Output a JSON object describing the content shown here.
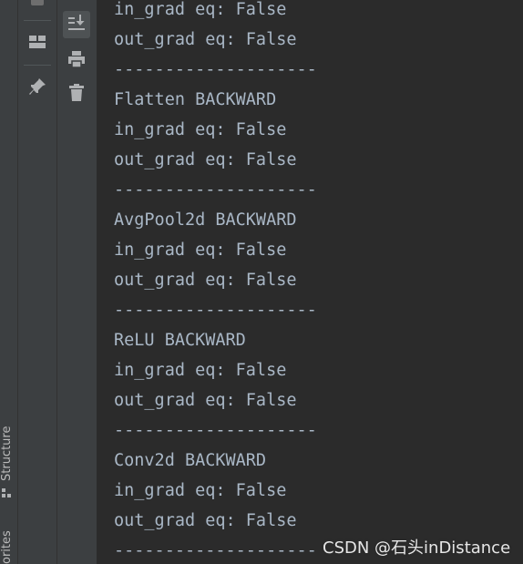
{
  "side_tabs": {
    "structure": "Structure",
    "favorites": "orites"
  },
  "tool_buttons": [
    {
      "icon": "layout-icon"
    },
    {
      "icon": "pin-icon"
    },
    {
      "icon": "scroll-to-end-icon"
    },
    {
      "icon": "print-icon"
    },
    {
      "icon": "trash-icon"
    }
  ],
  "console": {
    "lines": [
      "in_grad eq: False",
      "out_grad eq: False",
      "--------------------",
      "Flatten BACKWARD",
      "in_grad eq: False",
      "out_grad eq: False",
      "--------------------",
      "AvgPool2d BACKWARD",
      "in_grad eq: False",
      "out_grad eq: False",
      "--------------------",
      "ReLU BACKWARD",
      "in_grad eq: False",
      "out_grad eq: False",
      "--------------------",
      "Conv2d BACKWARD",
      "in_grad eq: False",
      "out_grad eq: False",
      "--------------------"
    ]
  },
  "watermark": "CSDN @石头inDistance",
  "colors": {
    "console_bg": "#2b2b2b",
    "toolbar_bg": "#3c3f41",
    "console_text": "#a9b7c6"
  }
}
